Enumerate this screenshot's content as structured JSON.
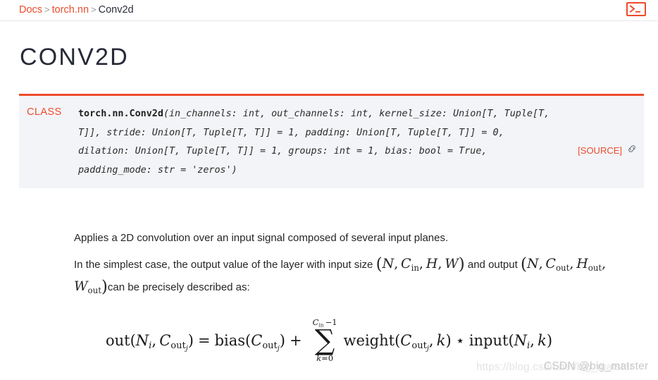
{
  "header": {
    "breadcrumb": {
      "items": [
        "Docs",
        "torch.nn",
        "Conv2d"
      ],
      "separator": ">"
    },
    "terminal_icon_name": "terminal-icon"
  },
  "title": "CONV2D",
  "signature": {
    "class_label": "CLASS",
    "qualified_name": "torch.nn.Conv2d",
    "open_paren": "(",
    "params_text": "in_channels: int, out_channels: int, kernel_size: Union[T, Tuple[T, T]], stride: Union[T, Tuple[T, T]] = 1, padding: Union[T, Tuple[T, T]] = 0, dilation: Union[T, Tuple[T, T]] = 1, groups: int = 1, bias: bool = True, padding_mode: str = 'zeros'",
    "close_paren": ")",
    "source_label": "[SOURCE]",
    "anchor_icon_name": "link-icon"
  },
  "body": {
    "paragraph1": "Applies a 2D convolution over an input signal composed of several input planes.",
    "paragraph2": {
      "lead": "In the simplest case, the output value of the layer with input size",
      "input_size": "(N, C_in, H, W)",
      "middle": "and output",
      "output_size": "(N, C_out, H_out, W_out)",
      "tail": "can be precisely described as:"
    }
  },
  "equation": {
    "latex": "out(N_i, C_out_j) = bias(C_out_j) + \\sum_{k=0}^{C_in-1} weight(C_out_j, k) \\star input(N_i, k)",
    "lhs_fn": "out",
    "bias_fn": "bias",
    "weight_fn": "weight",
    "input_fn": "input",
    "equals": "=",
    "plus": "+",
    "star": "⋆",
    "sum_symbol": "∑",
    "sum_upper": "C_in − 1",
    "sum_lower": "k=0"
  },
  "watermarks": {
    "url": "https://blog.csdn.net/big_matster",
    "label": "CSDN @big_matster"
  },
  "colors": {
    "accent": "#ee4c2c",
    "title": "#262a36",
    "code_bg": "#f3f4f7",
    "text": "#262626",
    "separator": "#e8e8e8"
  }
}
